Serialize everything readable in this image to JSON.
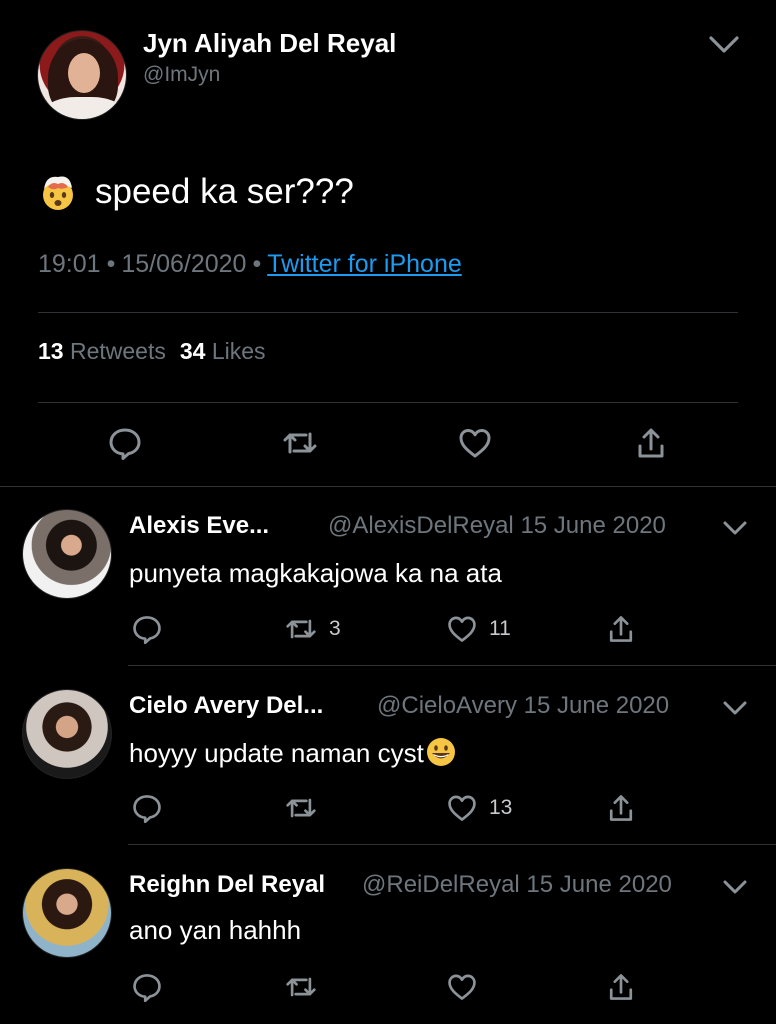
{
  "tweet": {
    "author_name": "Jyn Aliyah Del Reyal",
    "author_handle": "@ImJyn",
    "emoji": "🤯",
    "text": "speed ka ser???",
    "time": "19:01",
    "date": "15/06/2020",
    "source": "Twitter for iPhone",
    "retweets_count": "13",
    "retweets_label": "Retweets",
    "likes_count": "34",
    "likes_label": "Likes"
  },
  "icons": {
    "reply": "speech-bubble-icon",
    "retweet": "retweet-icon",
    "like": "heart-icon",
    "share": "share-icon",
    "menu": "chevron-down-icon"
  },
  "colors": {
    "background": "#000000",
    "muted": "#6e767d",
    "link": "#1d9bf0",
    "divider": "#2f3336"
  },
  "replies": [
    {
      "name": "Alexis Eve...",
      "handle": "@AlexisDelReyal",
      "date": "15 June 2020",
      "text": "punyeta magkakajowa ka na ata",
      "retweets": "3",
      "likes": "11"
    },
    {
      "name": "Cielo Avery Del...",
      "handle": "@CieloAvery",
      "date": "15 June 2020",
      "text": "hoyyy update naman cyst",
      "emoji": "😀",
      "retweets": "",
      "likes": "13"
    },
    {
      "name": "Reighn Del Reyal",
      "handle": "@ReiDelReyal",
      "date": "15 June 2020",
      "text": "ano yan hahhh",
      "retweets": "",
      "likes": ""
    }
  ]
}
